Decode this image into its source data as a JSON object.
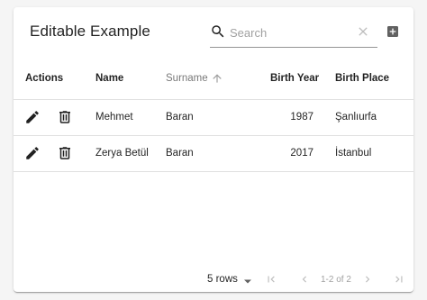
{
  "table": {
    "title": "Editable Example",
    "search": {
      "placeholder": "Search",
      "value": ""
    },
    "columns": {
      "actions": "Actions",
      "name": "Name",
      "surname": "Surname",
      "birth_year": "Birth Year",
      "birth_place": "Birth Place"
    },
    "rows": [
      {
        "name": "Mehmet",
        "surname": "Baran",
        "birth_year": "1987",
        "birth_place": "Şanlıurfa"
      },
      {
        "name": "Zerya Betül",
        "surname": "Baran",
        "birth_year": "2017",
        "birth_place": "İstanbul"
      }
    ],
    "pagination": {
      "rows_per_page": "5 rows",
      "range": "1-2 of 2"
    }
  },
  "colors": {
    "icon_dark": "#212121",
    "icon_muted": "#bdbdbd",
    "divider": "#e0e0e0"
  }
}
